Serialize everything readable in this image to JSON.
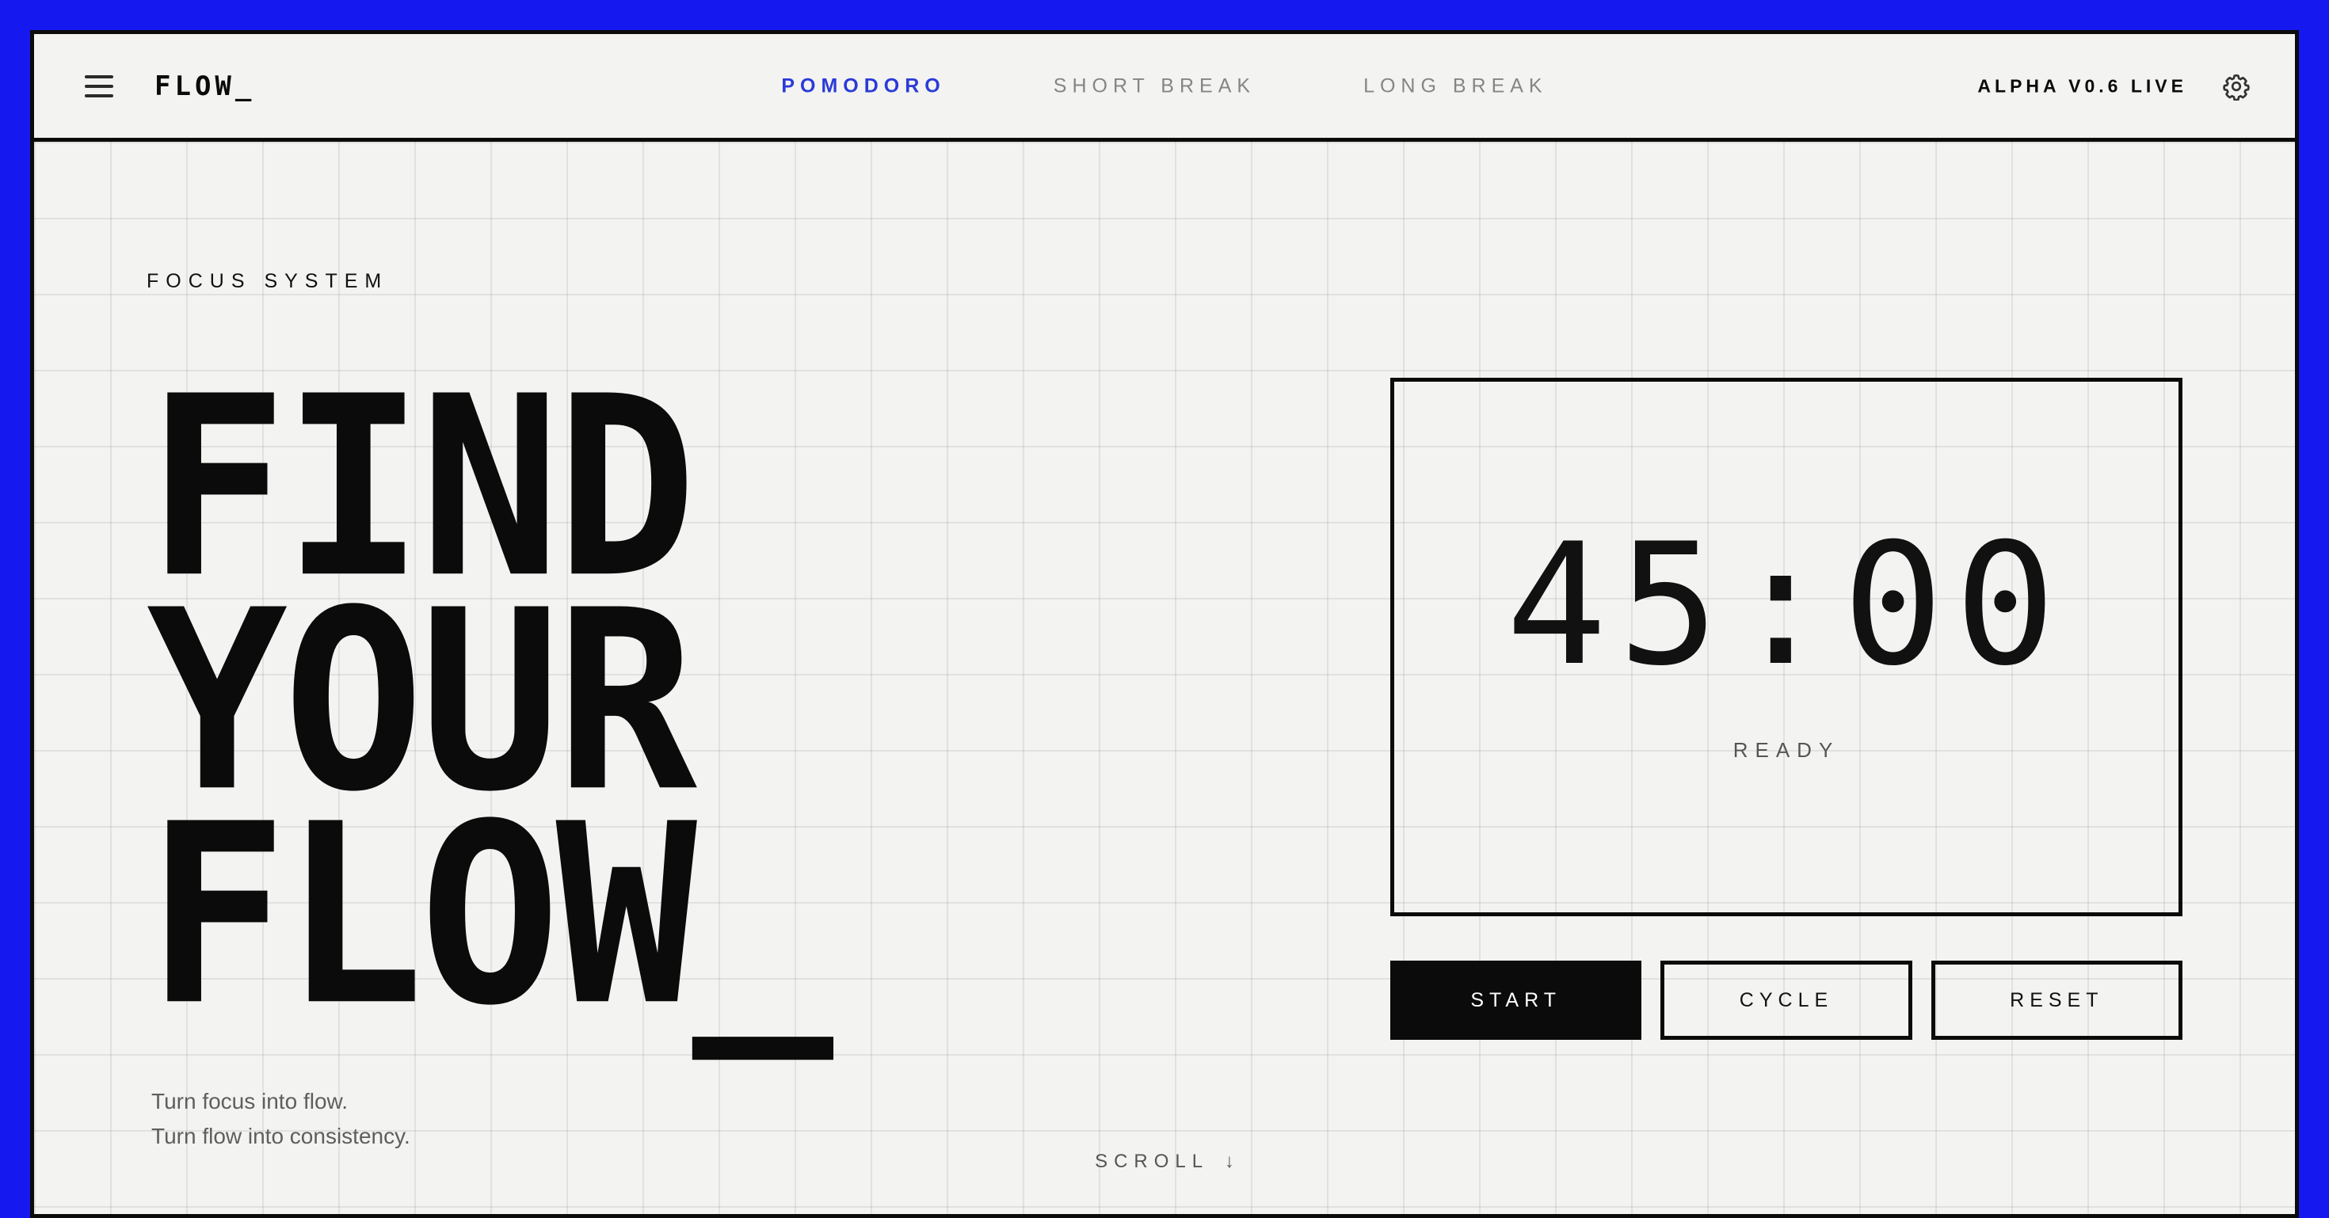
{
  "colors": {
    "accent": "#2b3ad8",
    "frame": "#1618f0",
    "background": "#f3f3f1",
    "ink": "#0b0b0b",
    "muted": "#858585"
  },
  "header": {
    "logo": "FLOW_",
    "menu_icon": "hamburger-menu-icon",
    "tabs": [
      {
        "label": "POMODORO",
        "active": true
      },
      {
        "label": "SHORT BREAK",
        "active": false
      },
      {
        "label": "LONG BREAK",
        "active": false
      }
    ],
    "version": "ALPHA V0.6 LIVE",
    "settings_icon": "gear-icon"
  },
  "hero": {
    "eyebrow": "FOCUS SYSTEM",
    "headline": [
      "FIND",
      "YOUR",
      "FLOW_"
    ],
    "tagline": [
      "Turn focus into flow.",
      "Turn flow into consistency."
    ]
  },
  "timer": {
    "time": "45:00",
    "status": "READY"
  },
  "controls": {
    "start": "START",
    "cycle": "CYCLE",
    "reset": "RESET"
  },
  "scroll": {
    "label": "SCROLL",
    "icon": "arrow-down-icon",
    "arrow": "↓"
  }
}
